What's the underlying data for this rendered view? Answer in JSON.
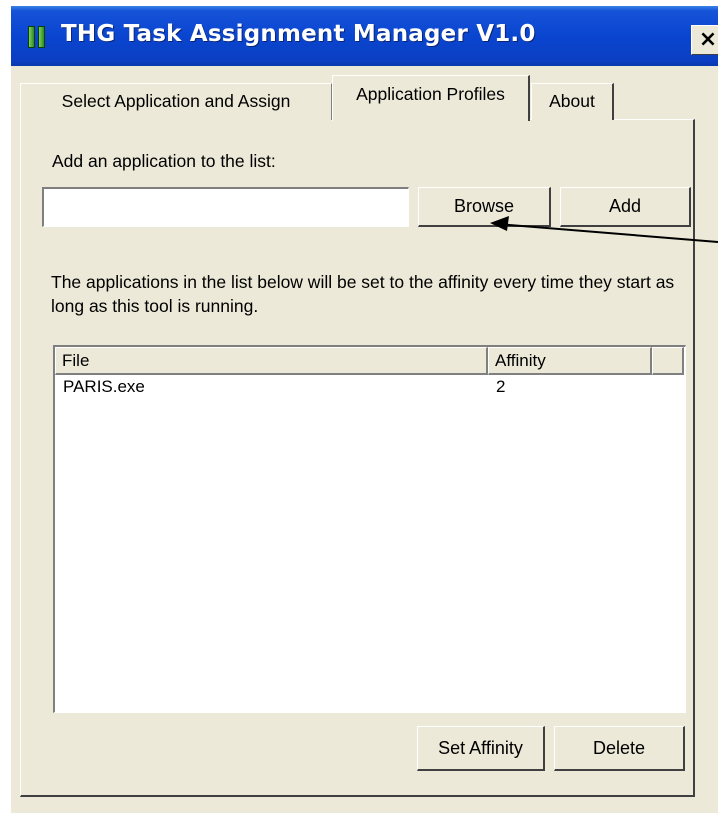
{
  "window": {
    "title": "THG Task Assignment Manager V1.0",
    "close_label": "×"
  },
  "tabs": [
    {
      "label": "Select Application and Assign",
      "active": false
    },
    {
      "label": "Application Profiles",
      "active": true
    },
    {
      "label": "About",
      "active": false
    }
  ],
  "add_section": {
    "label": "Add an application to the list:",
    "path_value": "",
    "browse_label": "Browse",
    "add_label": "Add"
  },
  "info_text": "The applications in the list below will be set to the affinity every time they start as long as this tool is running.",
  "list": {
    "columns": [
      "File",
      "Affinity",
      ""
    ],
    "rows": [
      {
        "file": "PARIS.exe",
        "affinity": "2"
      }
    ]
  },
  "footer_buttons": {
    "set_affinity_label": "Set Affinity",
    "delete_label": "Delete"
  },
  "colors": {
    "window_bg": "#ece9d8",
    "titlebar_blue": "#0a45d0",
    "title_text": "#ffffff",
    "annotation_arrow": "#000000"
  }
}
